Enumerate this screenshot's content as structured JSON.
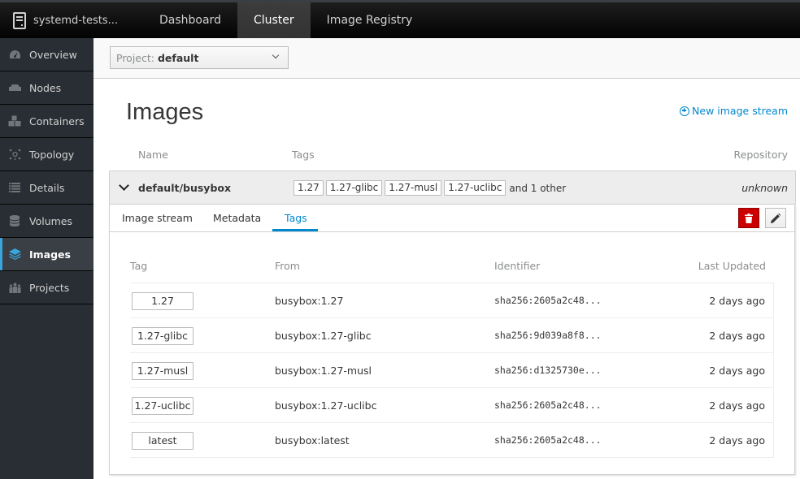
{
  "topbar": {
    "brand": "systemd-tests...",
    "nav": [
      {
        "label": "Dashboard",
        "active": false
      },
      {
        "label": "Cluster",
        "active": true
      },
      {
        "label": "Image Registry",
        "active": false
      }
    ]
  },
  "sidebar": {
    "items": [
      {
        "label": "Overview",
        "icon": "dashboard-icon",
        "active": false
      },
      {
        "label": "Nodes",
        "icon": "server-icon",
        "active": false
      },
      {
        "label": "Containers",
        "icon": "cubes-icon",
        "active": false
      },
      {
        "label": "Topology",
        "icon": "topology-icon",
        "active": false
      },
      {
        "label": "Details",
        "icon": "list-icon",
        "active": false
      },
      {
        "label": "Volumes",
        "icon": "database-icon",
        "active": false
      },
      {
        "label": "Images",
        "icon": "layers-icon",
        "active": true
      },
      {
        "label": "Projects",
        "icon": "users-icon",
        "active": false
      }
    ]
  },
  "project": {
    "label": "Project:",
    "value": "default"
  },
  "page": {
    "title": "Images",
    "new_stream_label": "New image stream"
  },
  "columns": {
    "name": "Name",
    "tags": "Tags",
    "repository": "Repository"
  },
  "image": {
    "name": "default/busybox",
    "tags": [
      "1.27",
      "1.27-glibc",
      "1.27-musl",
      "1.27-uclibc"
    ],
    "more_label": "and 1 other",
    "repository": "unknown"
  },
  "detail_tabs": [
    {
      "label": "Image stream",
      "active": false
    },
    {
      "label": "Metadata",
      "active": false
    },
    {
      "label": "Tags",
      "active": true
    }
  ],
  "tags_table": {
    "headers": {
      "tag": "Tag",
      "from": "From",
      "identifier": "Identifier",
      "updated": "Last Updated"
    },
    "rows": [
      {
        "tag": "1.27",
        "from": "busybox:1.27",
        "identifier": "sha256:2605a2c48...",
        "updated": "2 days ago"
      },
      {
        "tag": "1.27-glibc",
        "from": "busybox:1.27-glibc",
        "identifier": "sha256:9d039a8f8...",
        "updated": "2 days ago"
      },
      {
        "tag": "1.27-musl",
        "from": "busybox:1.27-musl",
        "identifier": "sha256:d1325730e...",
        "updated": "2 days ago"
      },
      {
        "tag": "1.27-uclibc",
        "from": "busybox:1.27-uclibc",
        "identifier": "sha256:2605a2c48...",
        "updated": "2 days ago"
      },
      {
        "tag": "latest",
        "from": "busybox:latest",
        "identifier": "sha256:2605a2c48...",
        "updated": "2 days ago"
      }
    ]
  },
  "colors": {
    "accent": "#0088ce",
    "sidebar_active": "#39a5dc",
    "danger": "#cc0000",
    "sidebar_bg": "#292e34"
  }
}
